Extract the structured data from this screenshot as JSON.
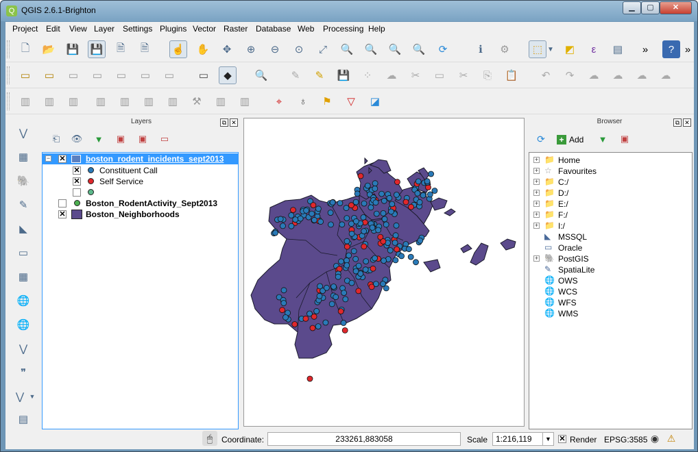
{
  "window": {
    "title": "QGIS 2.6.1-Brighton",
    "minimize_glyph": "▁",
    "maximize_glyph": "▢",
    "close_glyph": "✕"
  },
  "menu": [
    "Project",
    "Edit",
    "View",
    "Layer",
    "Settings",
    "Plugins",
    "Vector",
    "Raster",
    "Database",
    "Web",
    "Processing",
    "Help"
  ],
  "toolbars": {
    "overflow": "»"
  },
  "layers_panel": {
    "title": "Layers",
    "items": [
      {
        "label": "boston_rodent_incidents_sept2013",
        "checked": true,
        "selected": true
      },
      {
        "label": "Constituent Call",
        "checked": true,
        "color": "#2a7ab8"
      },
      {
        "label": "Self Service",
        "checked": true,
        "color": "#e0282c"
      },
      {
        "label": "",
        "checked": false,
        "color": "#5cb88a"
      },
      {
        "label": "Boston_RodentActivity_Sept2013",
        "checked": false,
        "color": "#4caf50"
      },
      {
        "label": "Boston_Neighborhoods",
        "checked": true,
        "color": "#5b4a8c"
      }
    ]
  },
  "browser_panel": {
    "title": "Browser",
    "add_label": "Add",
    "items": [
      {
        "label": "Home",
        "icon": "folder-icon",
        "expandable": true
      },
      {
        "label": "Favourites",
        "icon": "star-icon",
        "expandable": true
      },
      {
        "label": "C:/",
        "icon": "folder-icon",
        "expandable": true
      },
      {
        "label": "D:/",
        "icon": "folder-icon",
        "expandable": true
      },
      {
        "label": "E:/",
        "icon": "folder-icon",
        "expandable": true
      },
      {
        "label": "F:/",
        "icon": "folder-icon",
        "expandable": true
      },
      {
        "label": "I:/",
        "icon": "folder-icon",
        "expandable": true
      },
      {
        "label": "MSSQL",
        "icon": "mssql-icon",
        "expandable": false
      },
      {
        "label": "Oracle",
        "icon": "oracle-icon",
        "expandable": false
      },
      {
        "label": "PostGIS",
        "icon": "postgis-icon",
        "expandable": true
      },
      {
        "label": "SpatiaLite",
        "icon": "spatialite-icon",
        "expandable": false
      },
      {
        "label": "OWS",
        "icon": "globe-icon",
        "expandable": false
      },
      {
        "label": "WCS",
        "icon": "globe-icon",
        "expandable": false
      },
      {
        "label": "WFS",
        "icon": "globe-icon",
        "expandable": false
      },
      {
        "label": "WMS",
        "icon": "globe-icon",
        "expandable": false
      }
    ]
  },
  "status": {
    "coordinate_label": "Coordinate:",
    "coordinate_value": "233261,883058",
    "scale_label": "Scale",
    "scale_value": "1:216,119",
    "render_label": "Render",
    "render_checked": true,
    "crs": "EPSG:3585"
  },
  "colors": {
    "polygon_fill": "#5b4a8c",
    "polygon_stroke": "#1a1a2a",
    "constituent_call": "#2a7ab8",
    "self_service": "#e0282c",
    "selection": "#3399ff"
  }
}
